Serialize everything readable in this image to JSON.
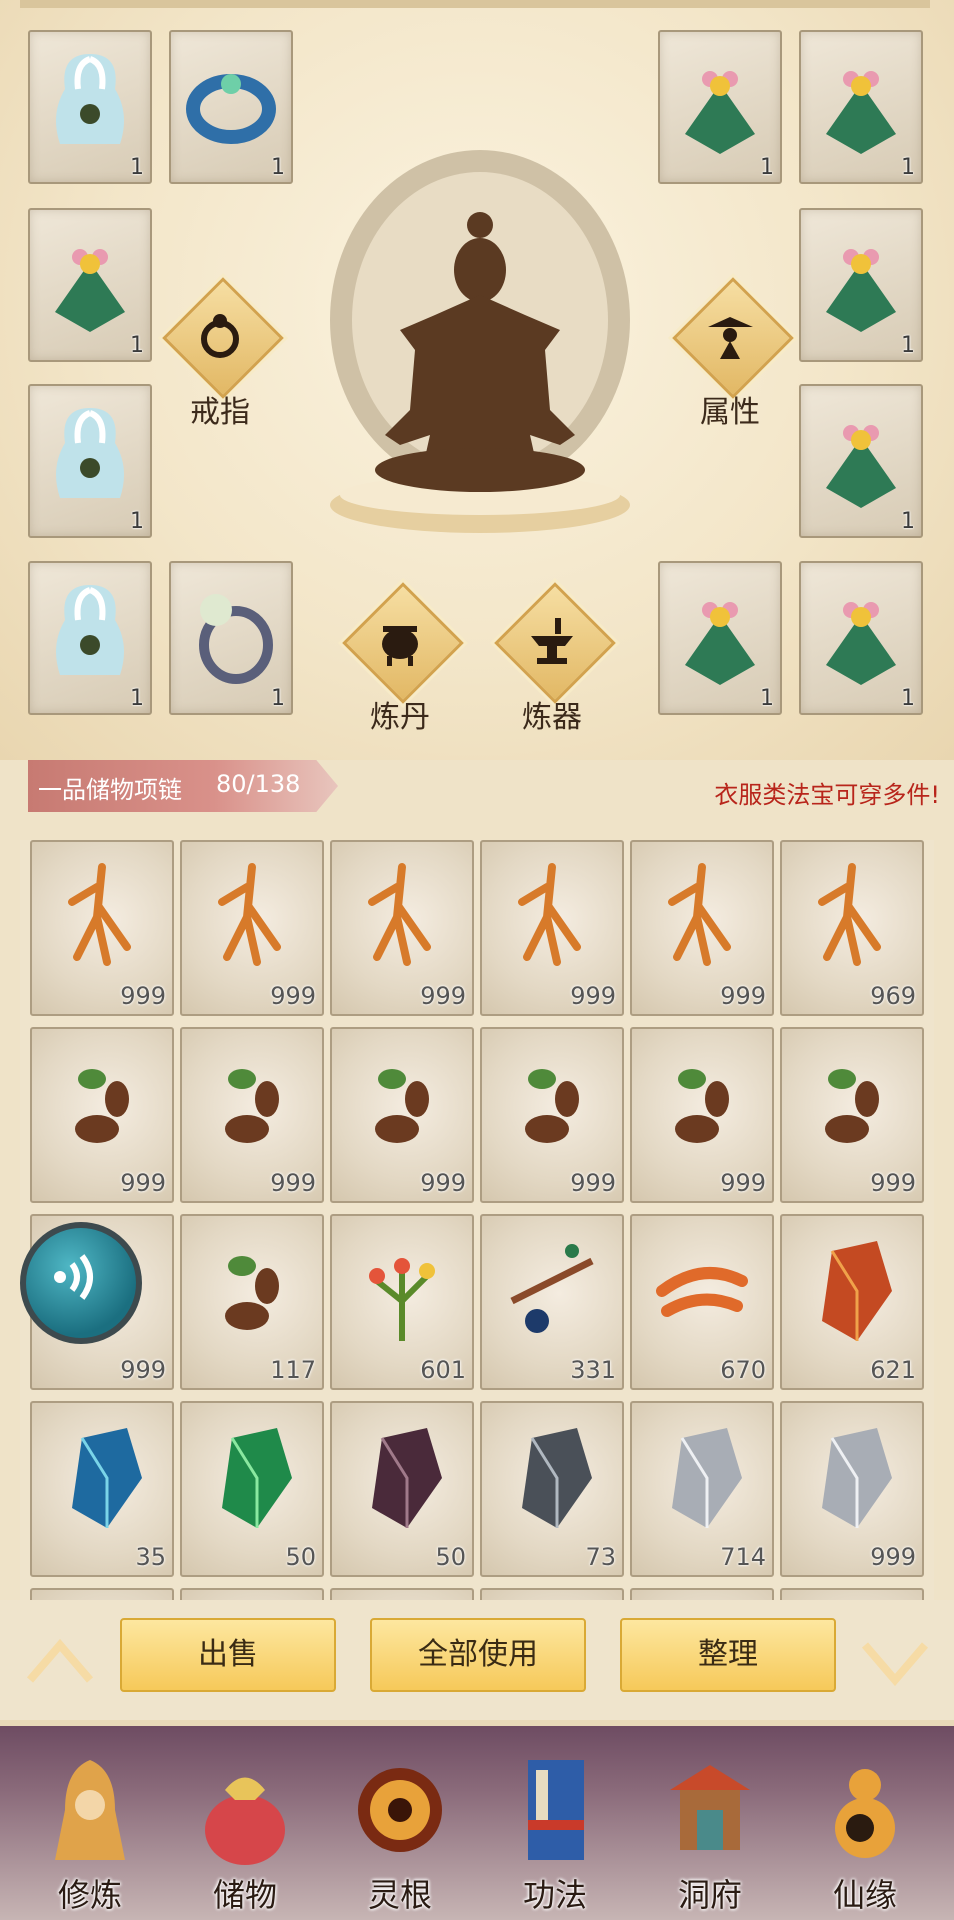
{
  "equipment_slots": {
    "left_col_1": [
      "1",
      "1",
      "1",
      "1"
    ],
    "left_col_2": [
      "1",
      "1"
    ],
    "right_col_1": [
      "1",
      "1"
    ],
    "right_col_2": [
      "1",
      "1",
      "1",
      "1"
    ]
  },
  "buttons": {
    "ring": "戒指",
    "attributes": "属性",
    "alchemy": "炼丹",
    "refining": "炼器"
  },
  "bag": {
    "name": "一品储物项链",
    "capacity": "80/138",
    "hint": "衣服类法宝可穿多件!"
  },
  "grid_items": [
    {
      "icon": "ginseng-icon",
      "qty": "999"
    },
    {
      "icon": "ginseng-icon",
      "qty": "999"
    },
    {
      "icon": "ginseng-icon",
      "qty": "999"
    },
    {
      "icon": "ginseng-icon",
      "qty": "999"
    },
    {
      "icon": "ginseng-icon",
      "qty": "999"
    },
    {
      "icon": "ginseng-icon",
      "qty": "969"
    },
    {
      "icon": "herb-root-icon",
      "qty": "999"
    },
    {
      "icon": "herb-root-icon",
      "qty": "999"
    },
    {
      "icon": "herb-root-icon",
      "qty": "999"
    },
    {
      "icon": "herb-root-icon",
      "qty": "999"
    },
    {
      "icon": "herb-root-icon",
      "qty": "999"
    },
    {
      "icon": "herb-root-icon",
      "qty": "999"
    },
    {
      "icon": "herb-root-icon",
      "qty": "999"
    },
    {
      "icon": "herb-root-icon",
      "qty": "117"
    },
    {
      "icon": "flower-herb-icon",
      "qty": "601"
    },
    {
      "icon": "berry-branch-icon",
      "qty": "331"
    },
    {
      "icon": "cordyceps-icon",
      "qty": "670"
    },
    {
      "icon": "red-crystal-icon",
      "qty": "621"
    },
    {
      "icon": "blue-crystal-icon",
      "qty": "35"
    },
    {
      "icon": "green-crystal-icon",
      "qty": "50"
    },
    {
      "icon": "purple-crystal-icon",
      "qty": "50"
    },
    {
      "icon": "grey-crystal-icon",
      "qty": "73"
    },
    {
      "icon": "silver-crystal-icon",
      "qty": "714"
    },
    {
      "icon": "silver-crystal-icon",
      "qty": "999"
    }
  ],
  "actions": {
    "sell": "出售",
    "use_all": "全部使用",
    "sort": "整理"
  },
  "nav": [
    "修炼",
    "储物",
    "灵根",
    "功法",
    "洞府",
    "仙缘"
  ],
  "colors": {
    "accent": "#f6c95a",
    "hint": "#b8251b"
  }
}
